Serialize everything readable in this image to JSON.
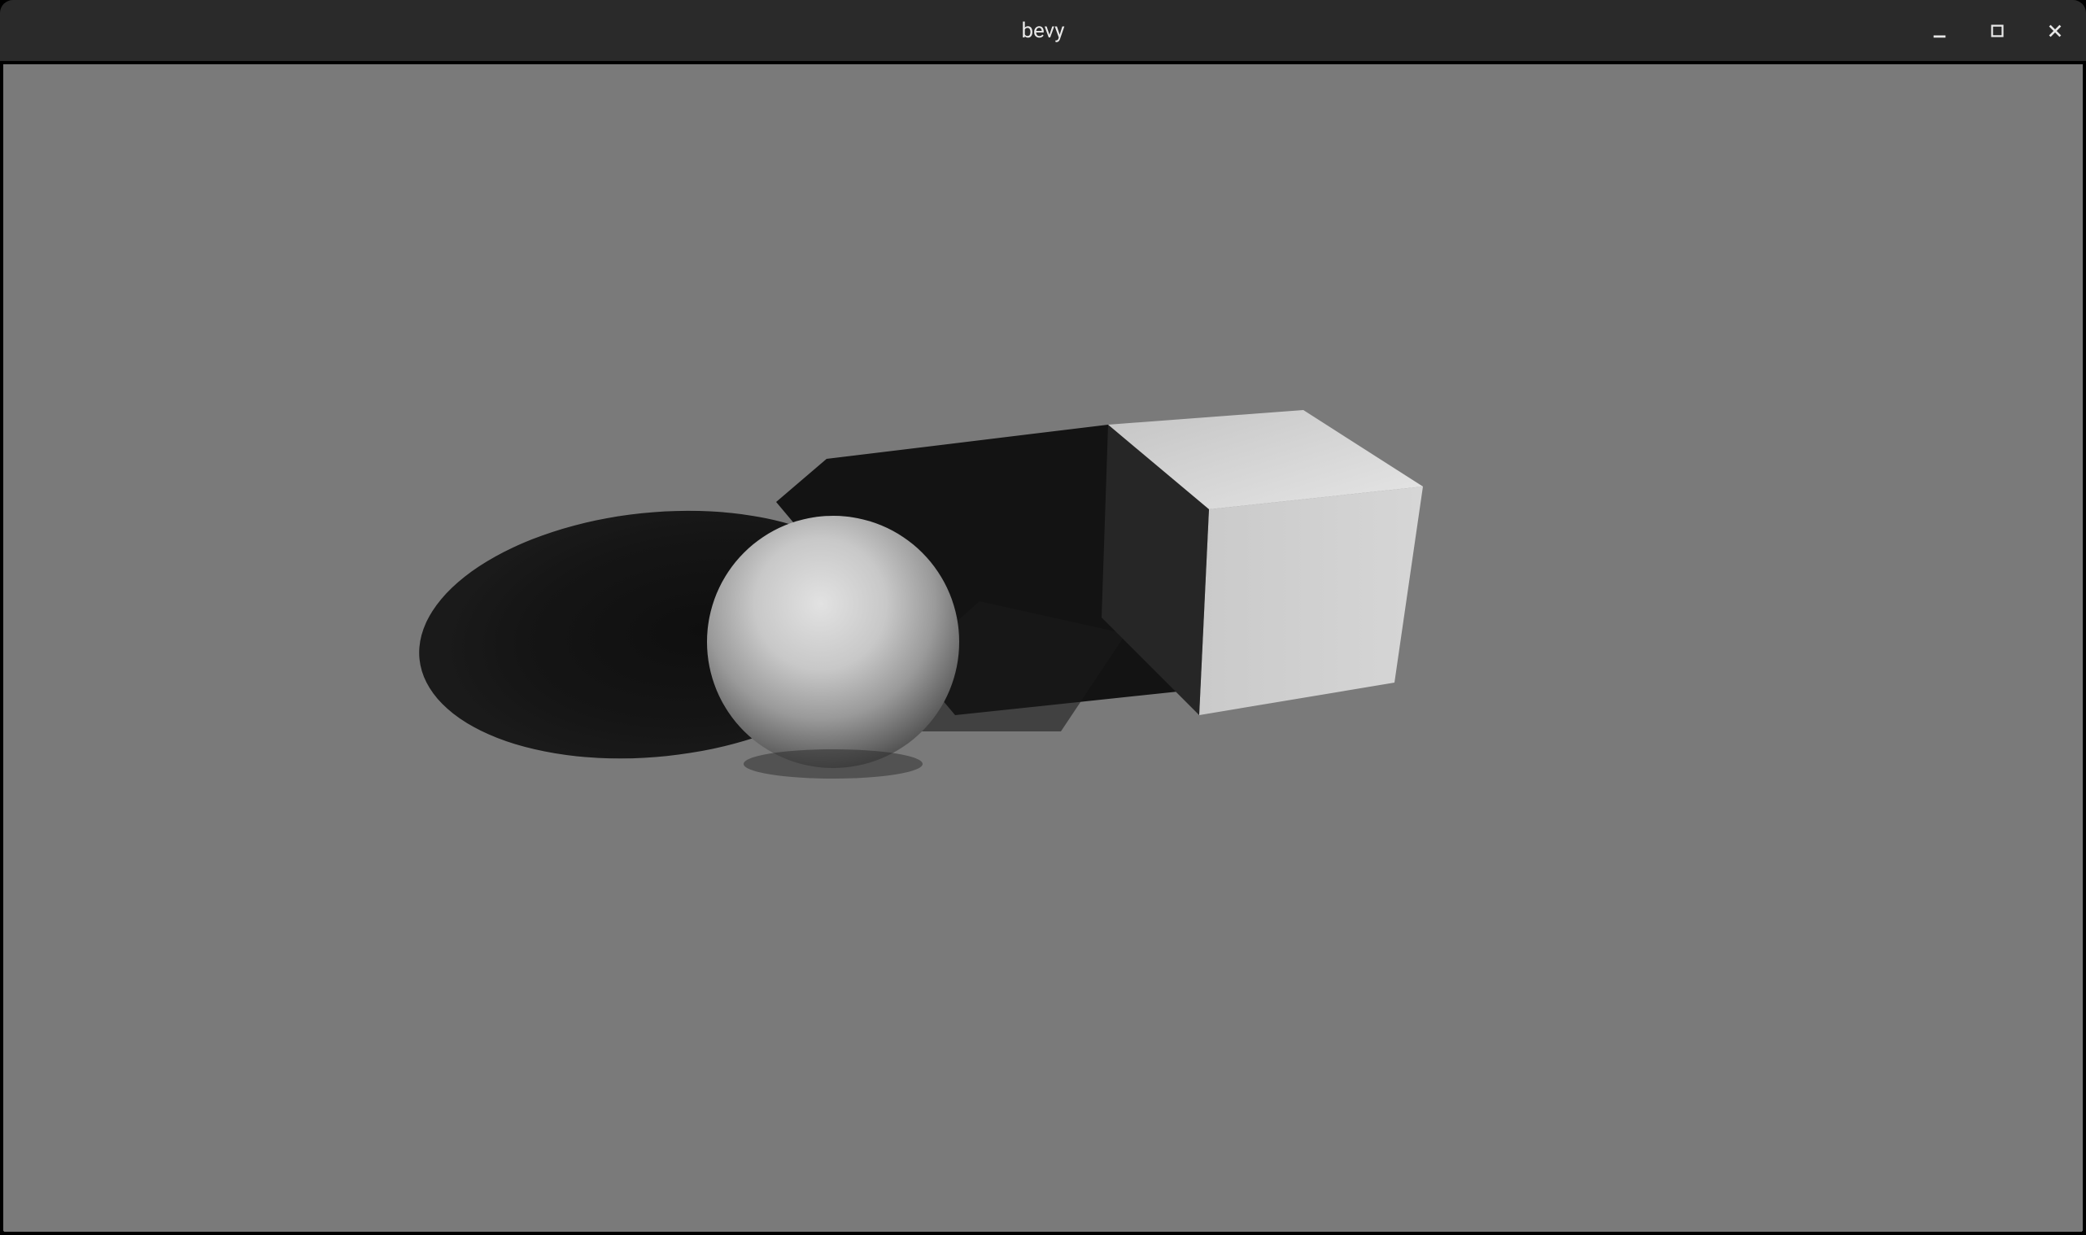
{
  "window": {
    "title": "bevy"
  },
  "scene": {
    "background_color": "#7a7a7a",
    "objects": [
      {
        "type": "sphere",
        "color_light": "#d8d8d8"
      },
      {
        "type": "cube",
        "color_light": "#d8d8d8"
      }
    ]
  }
}
